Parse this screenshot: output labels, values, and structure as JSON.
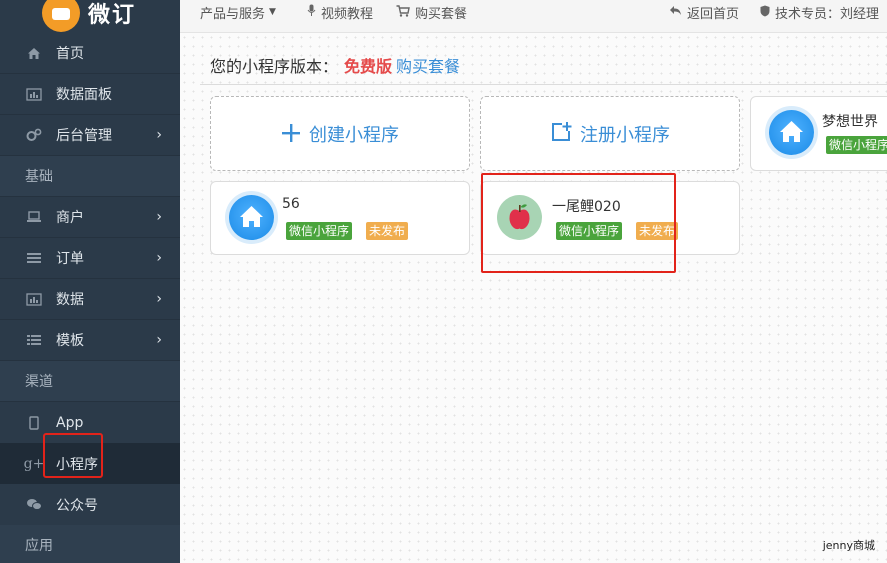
{
  "brand": {
    "logo_text": "微订"
  },
  "sidebar": {
    "items": [
      {
        "label": "首页",
        "icon": "home-icon"
      },
      {
        "label": "数据面板",
        "icon": "chart-icon"
      },
      {
        "label": "后台管理",
        "icon": "gears-icon",
        "chevron": "›"
      },
      {
        "section": "基础"
      },
      {
        "label": "商户",
        "icon": "laptop-icon",
        "chevron": "›"
      },
      {
        "label": "订单",
        "icon": "list-icon",
        "chevron": "›"
      },
      {
        "label": "数据",
        "icon": "chart-icon",
        "chevron": "›"
      },
      {
        "label": "模板",
        "icon": "th-list-icon",
        "chevron": "›"
      },
      {
        "section": "渠道"
      },
      {
        "label": "App",
        "icon": "tablet-icon"
      },
      {
        "label": "小程序",
        "icon": "google-plus-icon",
        "active": true
      },
      {
        "label": "公众号",
        "icon": "comments-icon"
      },
      {
        "section": "应用"
      }
    ]
  },
  "topbar": {
    "products": "产品与服务",
    "video": "视频教程",
    "buy_package": "购买套餐",
    "back_home": "返回首页",
    "support": "技术专员：刘经理"
  },
  "main": {
    "version_label": "您的小程序版本：",
    "version_value": "免费版",
    "buy_link": "购买套餐",
    "create_label": "创建小程序",
    "register_label": "注册小程序",
    "apps": [
      {
        "name": "梦想世界",
        "platform": "微信小程序"
      },
      {
        "name": "56",
        "platform": "微信小程序",
        "status": "未发布"
      },
      {
        "name": "一尾鲤020",
        "platform": "微信小程序",
        "status": "未发布"
      }
    ]
  },
  "watermark": "jenny商城",
  "colors": {
    "sidebar_bg": "#2b3a49",
    "accent_blue": "#3a8ed6",
    "free_red": "#e54b4b",
    "badge_green": "#4aa43c",
    "badge_orange": "#f0ad4e",
    "highlight_red": "#e2231a"
  }
}
